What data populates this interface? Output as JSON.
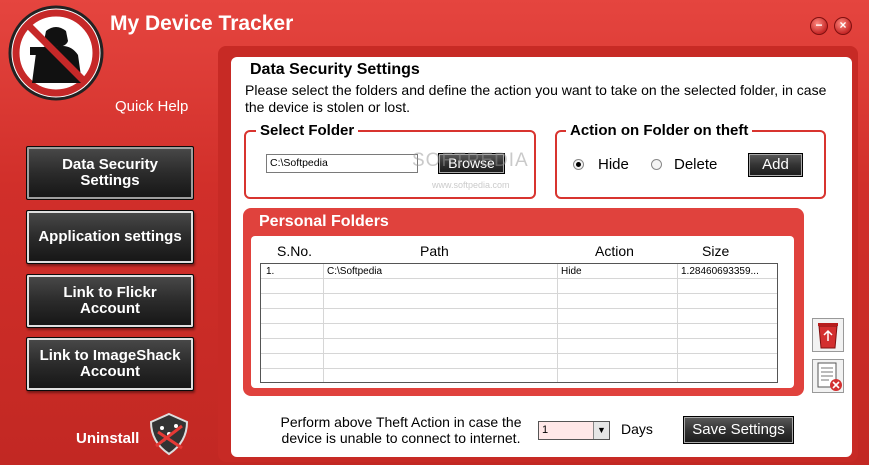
{
  "window": {
    "title": "My Device Tracker",
    "minimize_label": "−",
    "close_label": "×",
    "quick_help": "Quick Help"
  },
  "sidebar": {
    "items": [
      {
        "label": "Data Security\nSettings",
        "active": true
      },
      {
        "label": "Application settings",
        "active": false
      },
      {
        "label": "Link to Flickr\nAccount",
        "active": false
      },
      {
        "label": "Link to ImageShack\nAccount",
        "active": false
      }
    ],
    "uninstall": "Uninstall"
  },
  "main": {
    "title": "Data Security Settings",
    "description": "Please select the folders and define the action you want to take on the selected folder, in case the device is stolen or lost.",
    "select_folder": {
      "title": "Select Folder",
      "value": "C:\\Softpedia",
      "browse_label": "Browse"
    },
    "action": {
      "title": "Action on Folder on theft",
      "options": [
        "Hide",
        "Delete"
      ],
      "selected": "Hide",
      "add_label": "Add"
    },
    "personal_folders": {
      "title": "Personal Folders",
      "columns": [
        "S.No.",
        "Path",
        "Action",
        "Size"
      ],
      "rows": [
        {
          "sno": "1.",
          "path": "C:\\Softpedia",
          "action": "Hide",
          "size": "1.28460693359..."
        }
      ]
    },
    "footer": {
      "text": "Perform above Theft Action in case the device is unable to connect to internet.",
      "days_value": "1",
      "days_label": "Days",
      "save_label": "Save Settings"
    }
  },
  "watermark": {
    "text": "SOFTPEDIA",
    "url": "www.softpedia.com"
  },
  "colors": {
    "brand_red": "#d8342f",
    "panel_red": "#e0423d",
    "button_dark": "#2b2b2b"
  },
  "icons": [
    "no-spy-logo-icon",
    "shield-uninstall-icon",
    "recycle-bin-icon",
    "delete-document-icon"
  ]
}
